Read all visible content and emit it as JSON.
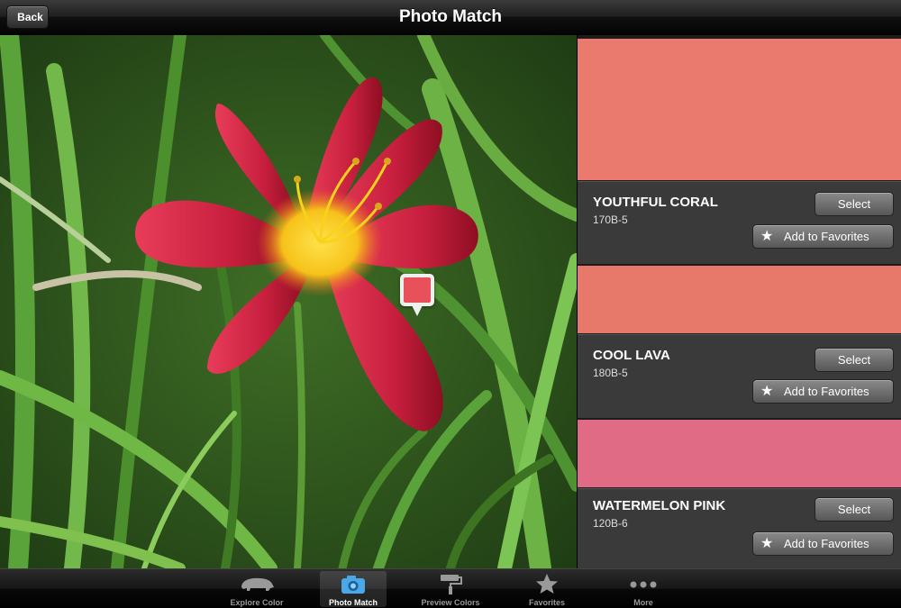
{
  "nav": {
    "title": "Photo Match",
    "back_label": "Back"
  },
  "picker": {
    "color": "#e8505a"
  },
  "colors": [
    {
      "name": "YOUTHFUL CORAL",
      "code": "170B-5",
      "hex": "#e97a6d",
      "select_label": "Select",
      "favorite_label": "Add to Favorites"
    },
    {
      "name": "COOL LAVA",
      "code": "180B-5",
      "hex": "#e7796a",
      "select_label": "Select",
      "favorite_label": "Add to Favorites"
    },
    {
      "name": "WATERMELON PINK",
      "code": "120B-6",
      "hex": "#e06b85",
      "select_label": "Select",
      "favorite_label": "Add to Favorites"
    }
  ],
  "tabs": [
    {
      "label": "Explore Color",
      "icon": "bear-icon"
    },
    {
      "label": "Photo Match",
      "icon": "camera-icon",
      "active": true
    },
    {
      "label": "Preview Colors",
      "icon": "paint-roller-icon"
    },
    {
      "label": "Favorites",
      "icon": "star-icon"
    },
    {
      "label": "More",
      "icon": "more-dots-icon"
    }
  ]
}
